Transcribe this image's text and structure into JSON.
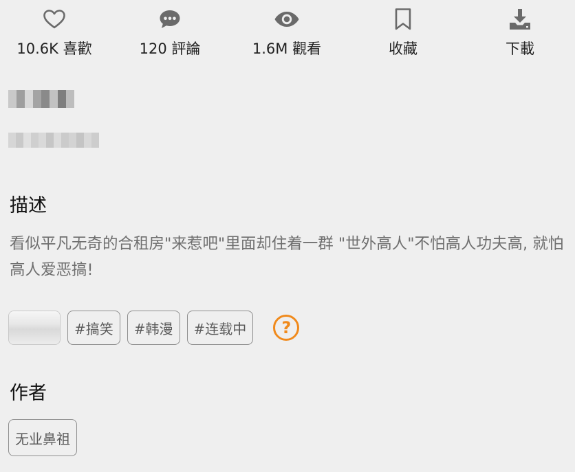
{
  "actions": {
    "like": {
      "label": "10.6K 喜歡",
      "icon": "heart-outline-icon"
    },
    "comment": {
      "label": "120 評論",
      "icon": "speech-bubble-icon"
    },
    "view": {
      "label": "1.6M 觀看",
      "icon": "eye-icon"
    },
    "favorite": {
      "label": "收藏",
      "icon": "bookmark-outline-icon"
    },
    "download": {
      "label": "下載",
      "icon": "download-tray-icon"
    }
  },
  "description": {
    "heading": "描述",
    "text": "看似平凡无奇的合租房\"来惹吧\"里面却住着一群 \"世外高人\"不怕高人功夫高, 就怕高人爱恶搞!"
  },
  "tags": [
    {
      "label": "#搞笑"
    },
    {
      "label": "#韩漫"
    },
    {
      "label": "#连载中"
    }
  ],
  "help_icon": {
    "glyph": "?",
    "color": "#f08a1c"
  },
  "author": {
    "heading": "作者",
    "name": "无业鼻祖"
  },
  "colors": {
    "background": "#efefef",
    "accent": "#f08a1c",
    "muted_text": "#6f6f6f"
  }
}
